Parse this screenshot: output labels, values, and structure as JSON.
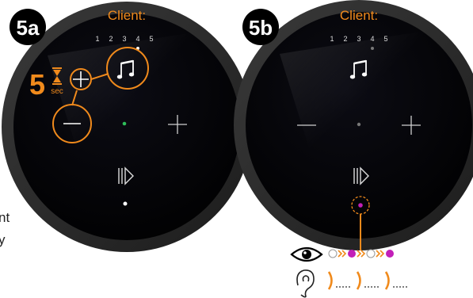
{
  "panel_a": {
    "step_label": "5a",
    "client_label": "Client:",
    "client_numbers": [
      "1",
      "2",
      "3",
      "4",
      "5"
    ],
    "active_client": "4",
    "hold_seconds": "5",
    "hold_unit": "sec"
  },
  "panel_b": {
    "step_label": "5b",
    "client_label": "Client:",
    "client_numbers": [
      "1",
      "2",
      "3",
      "4",
      "5"
    ],
    "active_client": "4"
  },
  "clipped_text": [
    "nt",
    "y"
  ],
  "colors": {
    "accent_orange": "#f08a1c",
    "led_green": "#2fbf5a",
    "led_magenta": "#c21fb8",
    "device_rim": "#2a2a2a",
    "device_face": "#050508"
  },
  "icons": [
    "music-note-icon",
    "plus-icon",
    "minus-icon",
    "play-pause-icon",
    "hourglass-icon",
    "eye-icon",
    "ear-icon"
  ]
}
